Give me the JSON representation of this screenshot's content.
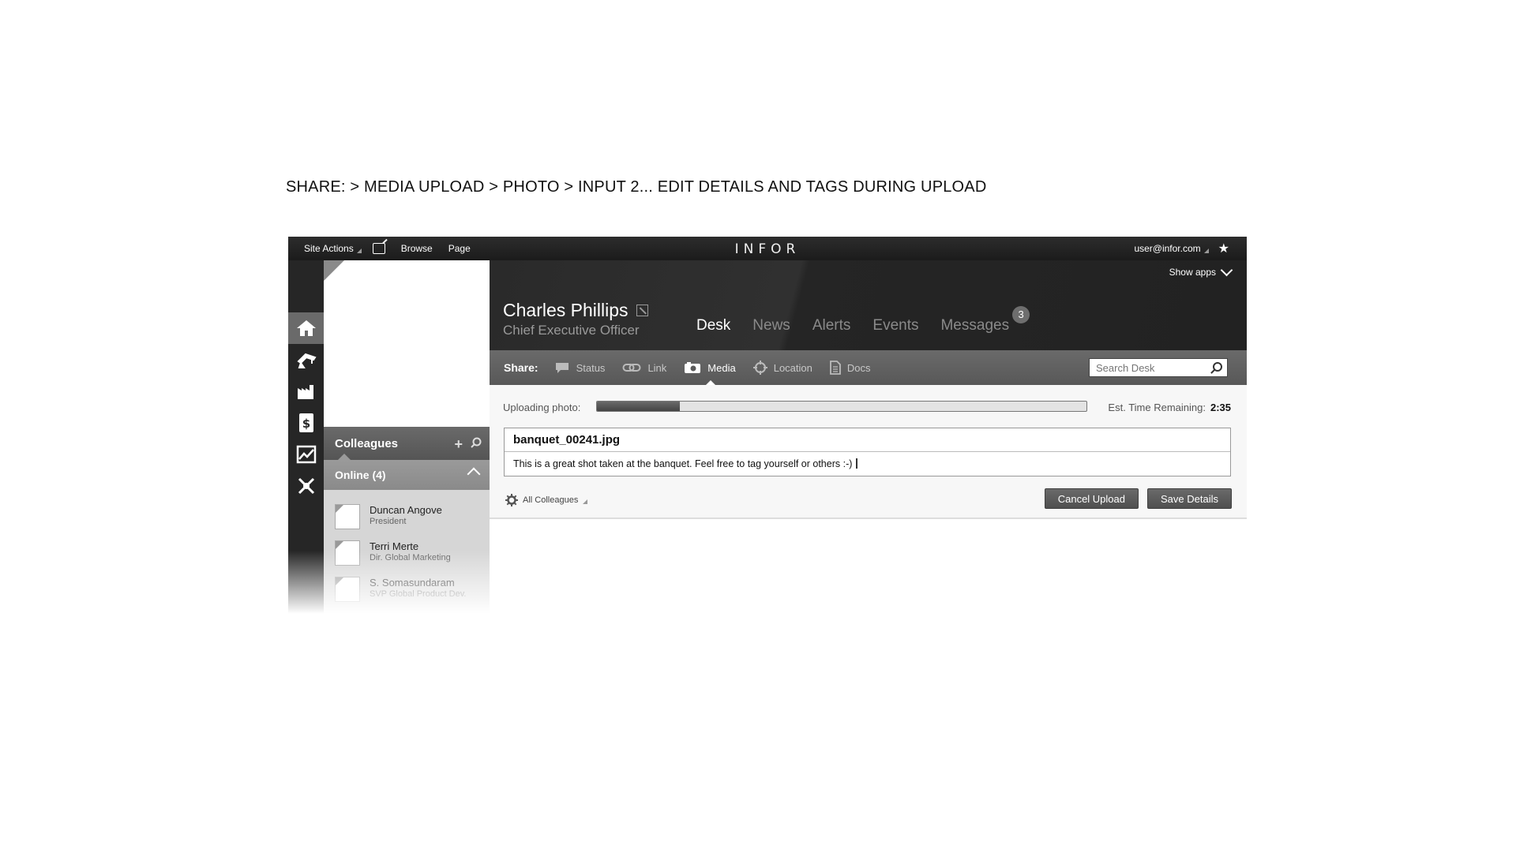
{
  "caption": "SHARE: > MEDIA UPLOAD > PHOTO > INPUT 2... EDIT DETAILS AND TAGS DURING UPLOAD",
  "topbar": {
    "site_actions": "Site Actions",
    "browse": "Browse",
    "page": "Page",
    "logo": "INFOR",
    "user": "user@infor.com"
  },
  "header": {
    "show_apps": "Show apps",
    "name": "Charles Phillips",
    "title": "Chief Executive Officer",
    "tabs": [
      {
        "label": "Desk",
        "active": true
      },
      {
        "label": "News"
      },
      {
        "label": "Alerts"
      },
      {
        "label": "Events"
      },
      {
        "label": "Messages",
        "badge": "3"
      }
    ]
  },
  "share": {
    "label": "Share:",
    "items": [
      {
        "label": "Status",
        "icon": "speech-bubble-icon"
      },
      {
        "label": "Link",
        "icon": "link-icon"
      },
      {
        "label": "Media",
        "icon": "camera-icon",
        "active": true
      },
      {
        "label": "Location",
        "icon": "crosshair-icon"
      },
      {
        "label": "Docs",
        "icon": "document-icon"
      }
    ],
    "search_placeholder": "Search Desk"
  },
  "sidebar": {
    "colleagues": "Colleagues",
    "online": "Online (4)",
    "people": [
      {
        "name": "Duncan Angove",
        "role": "President"
      },
      {
        "name": "Terri Merte",
        "role": "Dir. Global Marketing"
      },
      {
        "name": "S. Somasundaram",
        "role": "SVP Global Product Dev."
      }
    ]
  },
  "upload": {
    "label": "Uploading photo:",
    "progress_percent": 17,
    "eta_label": "Est. Time Remaining:",
    "eta_value": "2:35",
    "filename": "banquet_00241.jpg",
    "description": "This is a great shot taken at the banquet. Feel free to tag yourself or others :-)",
    "privacy": "All Colleagues",
    "cancel": "Cancel Upload",
    "save": "Save Details"
  }
}
